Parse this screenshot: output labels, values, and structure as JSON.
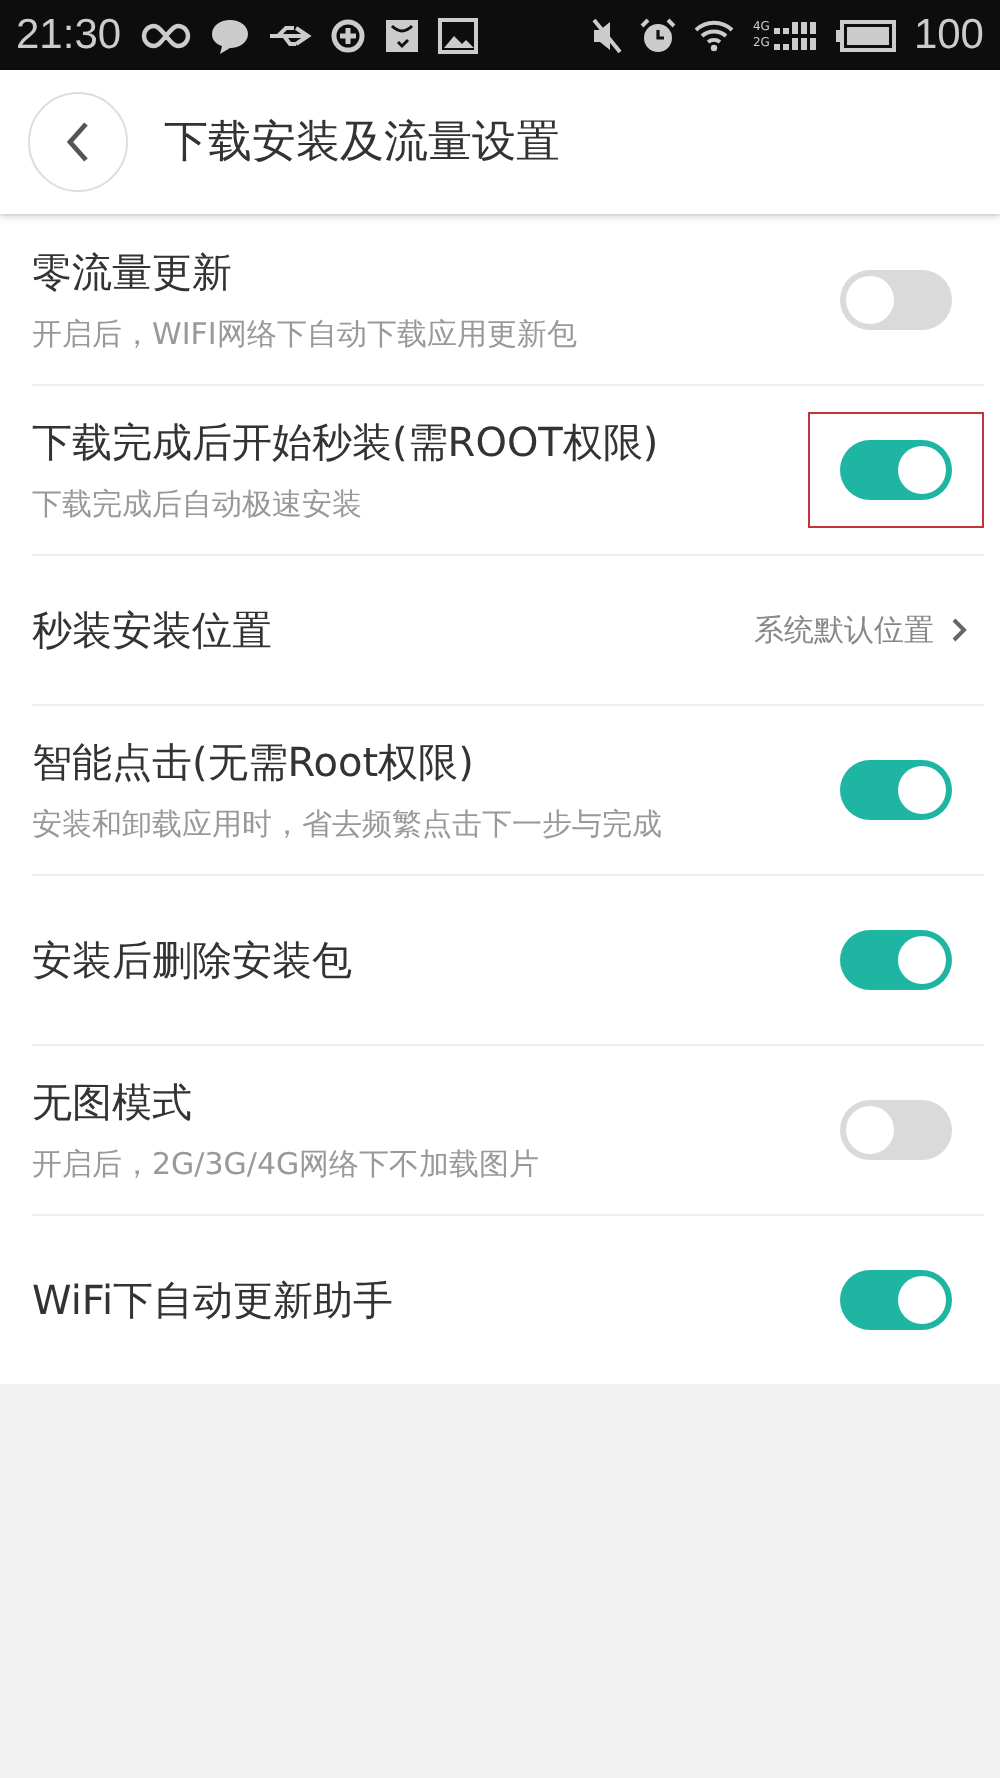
{
  "status_bar": {
    "time": "21:30",
    "network_labels": [
      "4G",
      "2G"
    ],
    "battery": "100"
  },
  "header": {
    "title": "下载安装及流量设置"
  },
  "settings": [
    {
      "kind": "toggle",
      "title": "零流量更新",
      "subtitle": "开启后，WIFI网络下自动下载应用更新包",
      "on": false,
      "highlighted": false
    },
    {
      "kind": "toggle",
      "title": "下载完成后开始秒装(需ROOT权限)",
      "subtitle": "下载完成后自动极速安装",
      "on": true,
      "highlighted": true
    },
    {
      "kind": "link",
      "title": "秒装安装位置",
      "value": "系统默认位置"
    },
    {
      "kind": "toggle",
      "title": "智能点击(无需Root权限)",
      "subtitle": "安装和卸载应用时，省去频繁点击下一步与完成",
      "on": true,
      "highlighted": false
    },
    {
      "kind": "toggle",
      "title": "安装后删除安装包",
      "on": true,
      "highlighted": false
    },
    {
      "kind": "toggle",
      "title": "无图模式",
      "subtitle": "开启后，2G/3G/4G网络下不加载图片",
      "on": false,
      "highlighted": false
    },
    {
      "kind": "toggle",
      "title": "WiFi下自动更新助手",
      "on": true,
      "highlighted": false
    }
  ]
}
